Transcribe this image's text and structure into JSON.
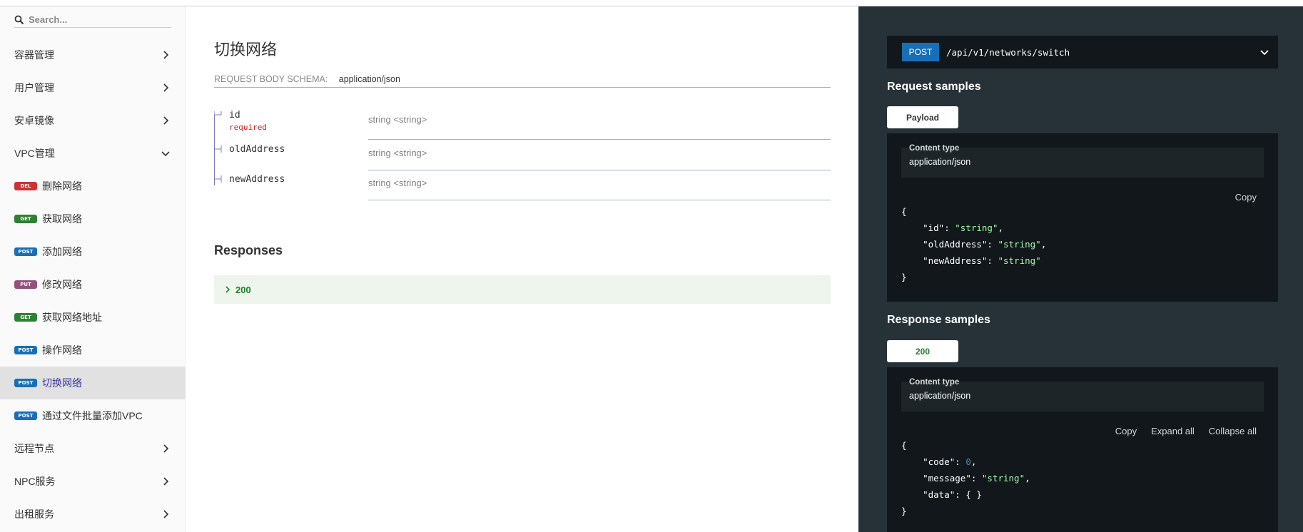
{
  "search": {
    "placeholder": "Search..."
  },
  "sidebar": {
    "items": [
      {
        "label": "容器管理",
        "type": "group"
      },
      {
        "label": "用户管理",
        "type": "group"
      },
      {
        "label": "安卓镜像",
        "type": "group"
      },
      {
        "label": "VPC管理",
        "type": "group-open"
      },
      {
        "label": "删除网络",
        "method": "DEL"
      },
      {
        "label": "获取网络",
        "method": "GET"
      },
      {
        "label": "添加网络",
        "method": "POST"
      },
      {
        "label": "修改网络",
        "method": "PUT"
      },
      {
        "label": "获取网络地址",
        "method": "GET"
      },
      {
        "label": "操作网络",
        "method": "POST"
      },
      {
        "label": "切换网络",
        "method": "POST",
        "active": true
      },
      {
        "label": "通过文件批量添加VPC",
        "method": "POST"
      },
      {
        "label": "远程节点",
        "type": "group"
      },
      {
        "label": "NPC服务",
        "type": "group"
      },
      {
        "label": "出租服务",
        "type": "group"
      }
    ]
  },
  "main": {
    "title": "切换网络",
    "schema_label": "REQUEST BODY SCHEMA:",
    "schema_type": "application/json",
    "params": [
      {
        "name": "id",
        "required": "required",
        "type": "string <string>"
      },
      {
        "name": "oldAddress",
        "type": "string <string>"
      },
      {
        "name": "newAddress",
        "type": "string <string>"
      }
    ],
    "responses_title": "Responses",
    "response_code": "200"
  },
  "right": {
    "method": "POST",
    "path": "/api/v1/networks/switch",
    "request_samples_title": "Request samples",
    "request_tab": "Payload",
    "request_content_type_label": "Content type",
    "request_content_type": "application/json",
    "copy_label": "Copy",
    "request_code": {
      "open": "{",
      "close": "}",
      "lines": [
        {
          "key": "\"id\"",
          "value": "\"string\"",
          "comma": ","
        },
        {
          "key": "\"oldAddress\"",
          "value": "\"string\"",
          "comma": ","
        },
        {
          "key": "\"newAddress\"",
          "value": "\"string\"",
          "comma": ""
        }
      ]
    },
    "response_samples_title": "Response samples",
    "response_tab": "200",
    "response_content_type_label": "Content type",
    "response_content_type": "application/json",
    "expand_all_label": "Expand all",
    "collapse_all_label": "Collapse all",
    "response_code": {
      "open": "{",
      "close": "}",
      "code_key": "\"code\"",
      "code_value": "0",
      "message_key": "\"message\"",
      "message_value": "\"string\"",
      "data_key": "\"data\"",
      "data_value": "{ }"
    }
  },
  "colors": {
    "del": "#cc3333",
    "get": "#2f8132",
    "post": "#186fb5",
    "put": "#95507c",
    "panel": "#263238"
  }
}
